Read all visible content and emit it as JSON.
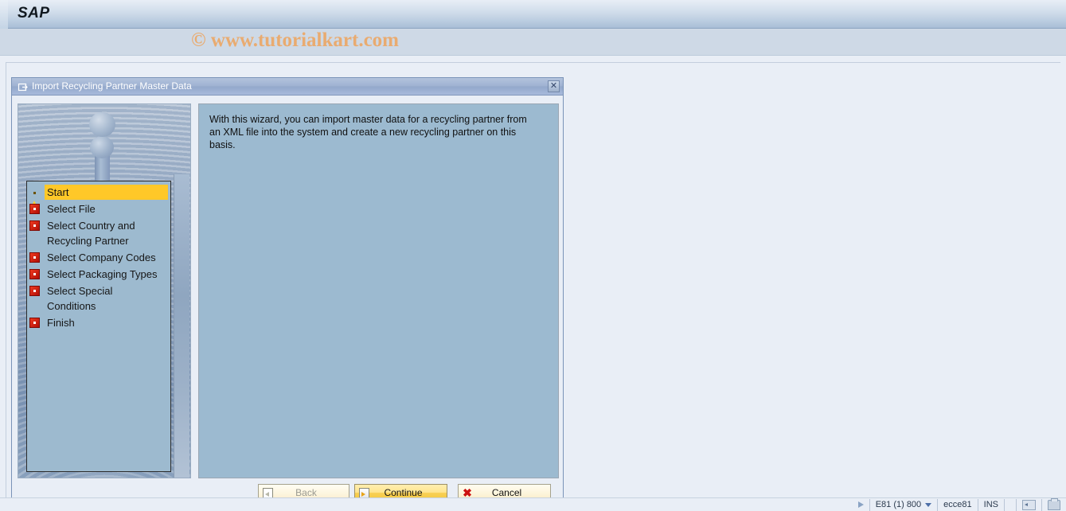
{
  "banner": {
    "logo": "SAP"
  },
  "watermark": {
    "text": "© www.tutorialkart.com"
  },
  "dialog": {
    "title": "Import Recycling Partner Master Data",
    "title_icon": "window-restore-icon",
    "close_label": "✕",
    "content_text": "With this wizard, you can import master data for a recycling partner from an XML file into the system and create a new recycling partner on this basis.",
    "steps": [
      {
        "label": "Start",
        "icon": "warning-triangle-icon",
        "state": "active"
      },
      {
        "label": "Select File",
        "icon": "red-square-icon",
        "state": "pending"
      },
      {
        "label": "Select Country and\nRecycling Partner",
        "icon": "red-square-icon",
        "state": "pending"
      },
      {
        "label": "Select Company Codes",
        "icon": "red-square-icon",
        "state": "pending"
      },
      {
        "label": "Select Packaging Types",
        "icon": "red-square-icon",
        "state": "pending"
      },
      {
        "label": "Select Special\nConditions",
        "icon": "red-square-icon",
        "state": "pending"
      },
      {
        "label": "Finish",
        "icon": "red-square-icon",
        "state": "pending"
      }
    ],
    "buttons": {
      "back": "Back",
      "continue": "Continue",
      "cancel": "Cancel"
    }
  },
  "statusbar": {
    "system": "E81 (1) 800",
    "user": "ecce81",
    "mode": "INS"
  },
  "colors": {
    "accent_yellow": "#ffc828",
    "content_panel": "#9cbad0",
    "title_bar": "#9fb2d2",
    "watermark_orange": "#e9ab70",
    "step_icon_red": "#d3180c"
  }
}
